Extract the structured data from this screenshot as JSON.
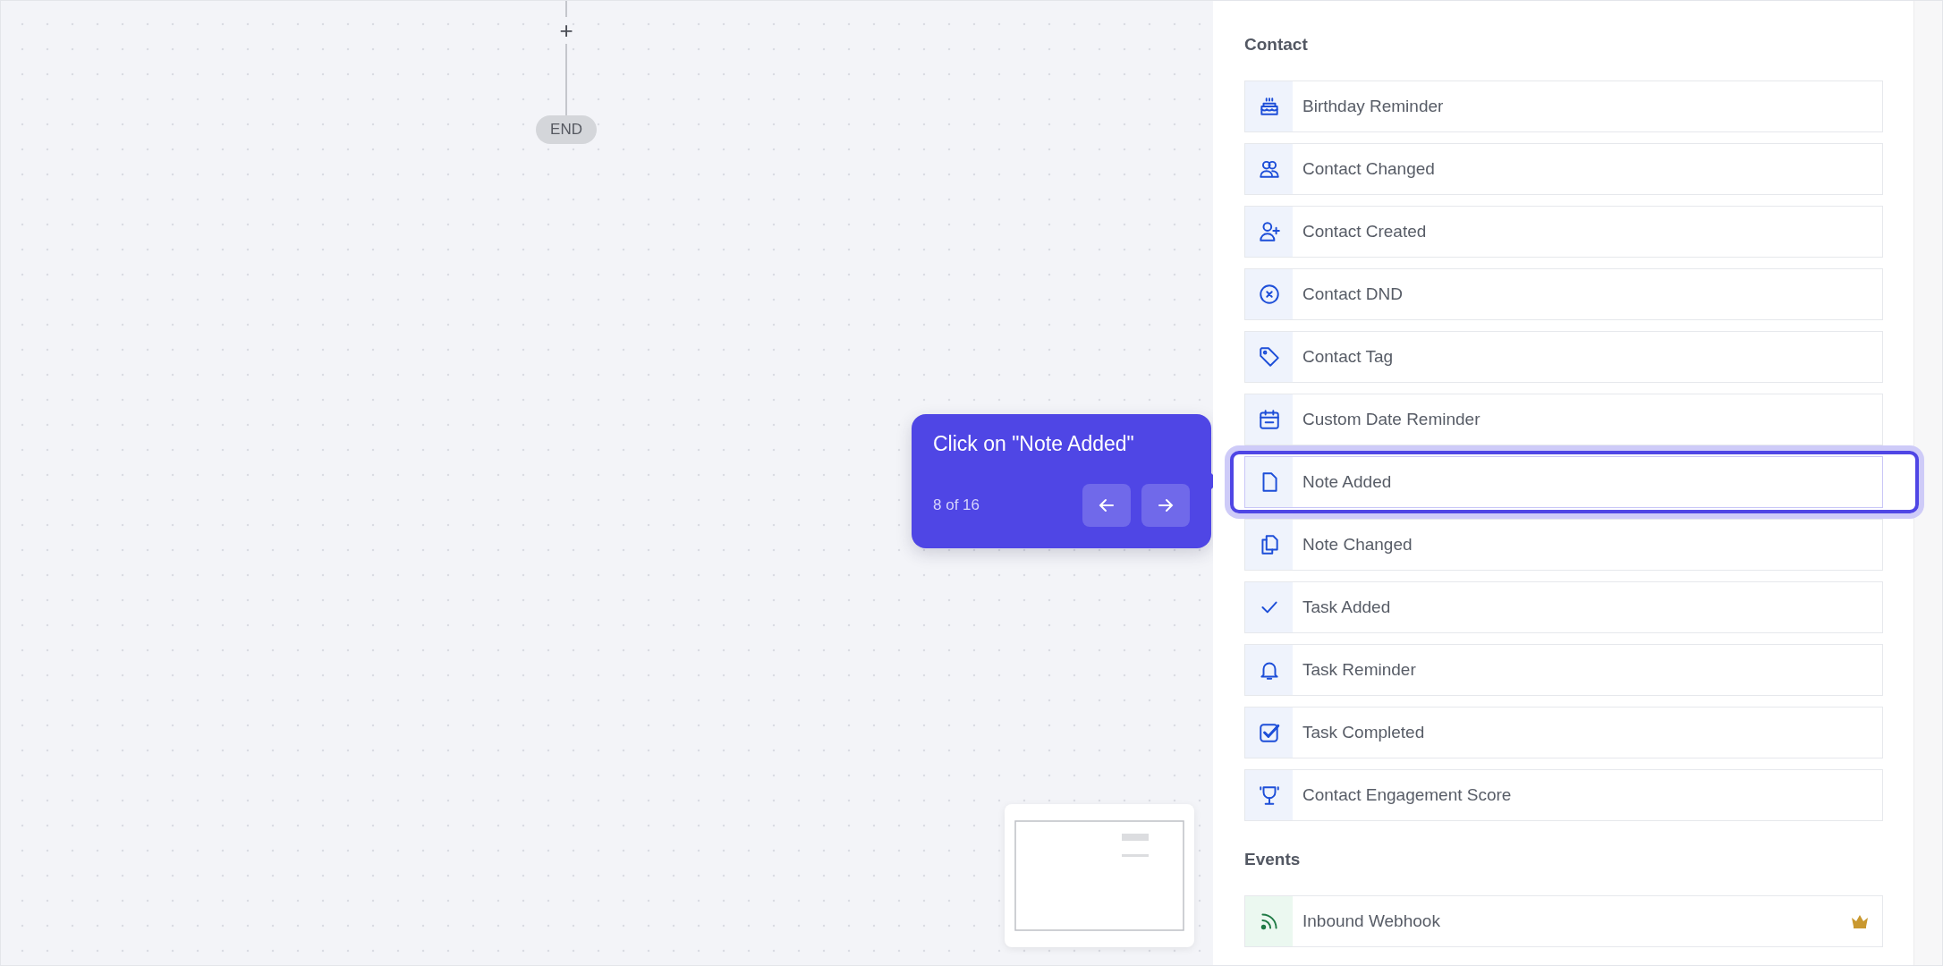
{
  "canvas": {
    "add_label": "+",
    "end_node": "END"
  },
  "tooltip": {
    "title": "Click on \"Note Added\"",
    "step": "8 of 16"
  },
  "sections": [
    {
      "heading": "Contact",
      "items": [
        {
          "label": "Birthday Reminder",
          "kind": "contact",
          "selected": false
        },
        {
          "label": "Contact Changed",
          "kind": "contact",
          "selected": false
        },
        {
          "label": "Contact Created",
          "kind": "contact",
          "selected": false
        },
        {
          "label": "Contact DND",
          "kind": "contact",
          "selected": false
        },
        {
          "label": "Contact Tag",
          "kind": "contact",
          "selected": false
        },
        {
          "label": "Custom Date Reminder",
          "kind": "contact",
          "selected": false
        },
        {
          "label": "Note Added",
          "kind": "contact",
          "selected": true
        },
        {
          "label": "Note Changed",
          "kind": "contact",
          "selected": false
        },
        {
          "label": "Task Added",
          "kind": "contact",
          "selected": false
        },
        {
          "label": "Task Reminder",
          "kind": "contact",
          "selected": false
        },
        {
          "label": "Task Completed",
          "kind": "contact",
          "selected": false
        },
        {
          "label": "Contact Engagement Score",
          "kind": "contact",
          "selected": false
        }
      ]
    },
    {
      "heading": "Events",
      "items": [
        {
          "label": "Inbound Webhook",
          "kind": "event",
          "selected": false,
          "premium": true
        }
      ]
    }
  ]
}
